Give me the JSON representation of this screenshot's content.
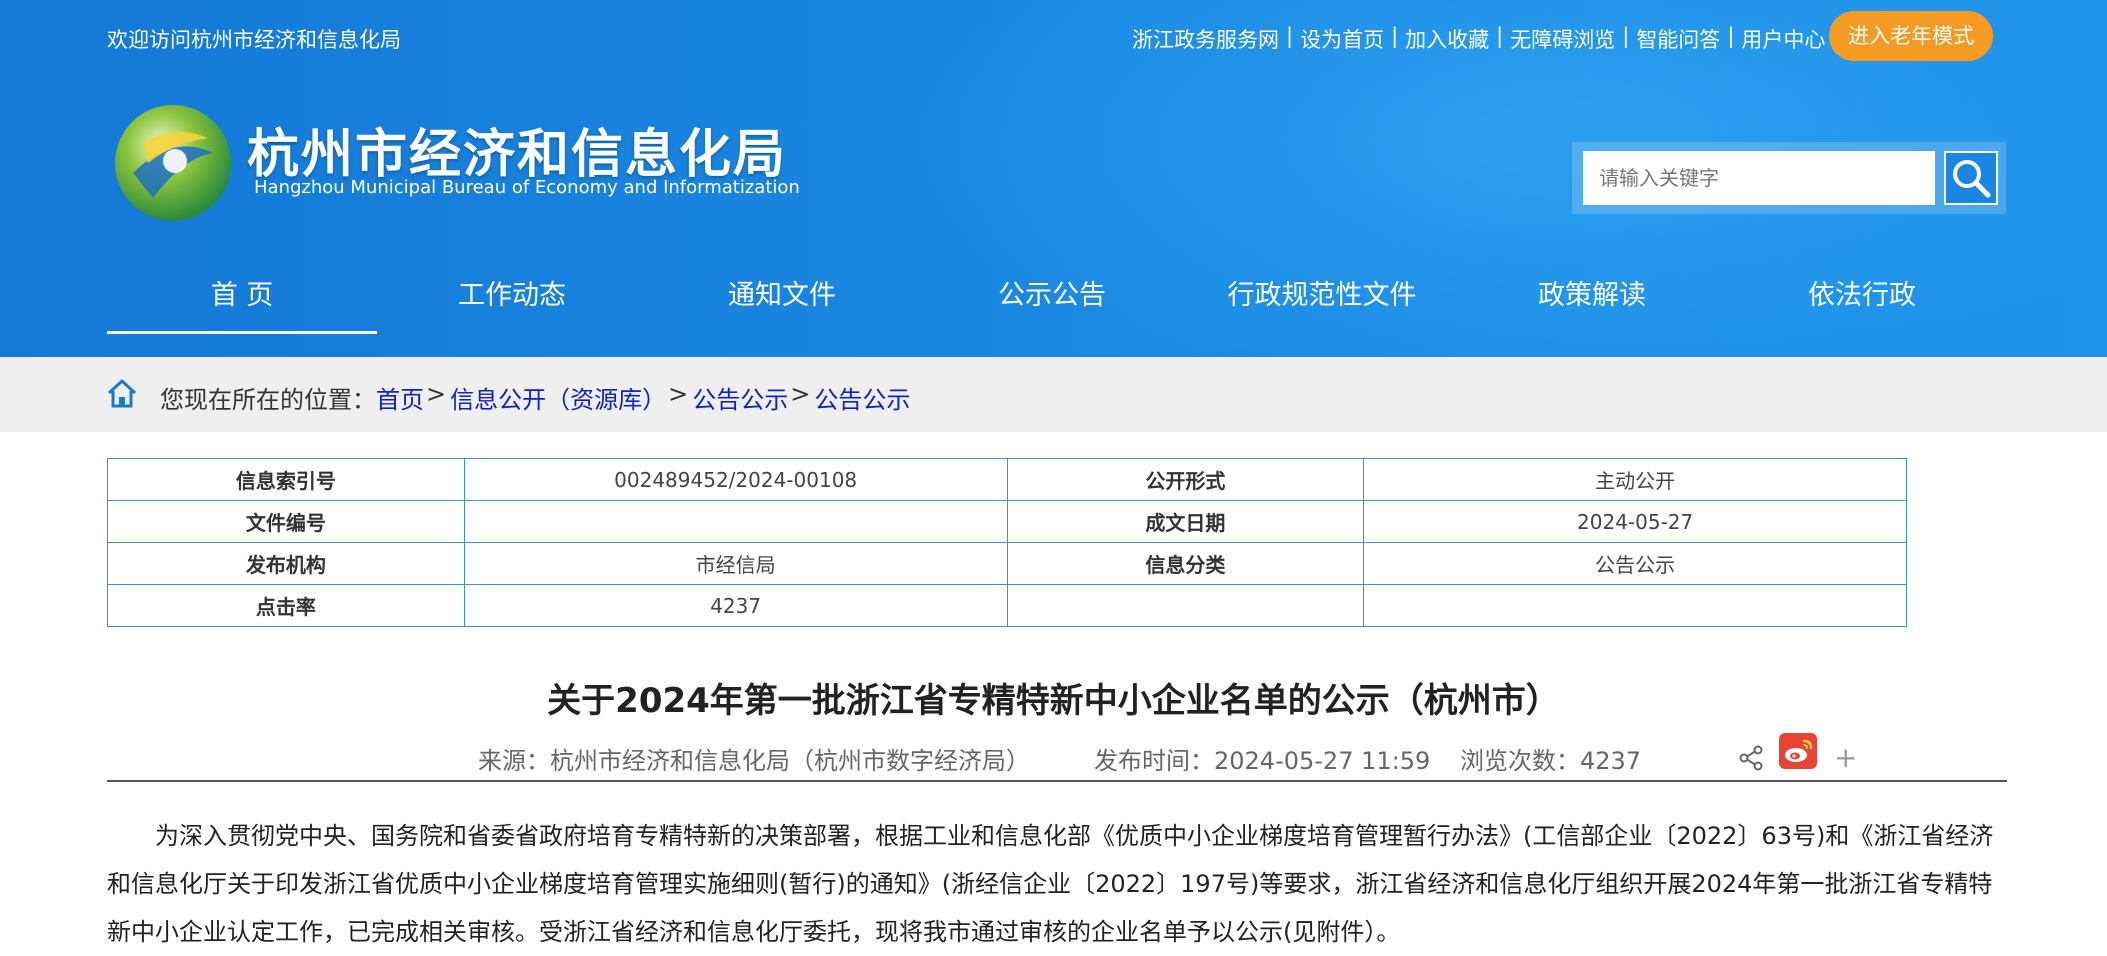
{
  "header": {
    "welcome": "欢迎访问杭州市经济和信息化局",
    "top_links": [
      "浙江政务服务网",
      "设为首页",
      "加入收藏",
      "无障碍浏览",
      "智能问答",
      "用户中心"
    ],
    "separator": "|",
    "elder_mode": "进入老年模式",
    "site_title": "杭州市经济和信息化局",
    "site_subtitle": "Hangzhou Municipal Bureau of Economy and Informatization",
    "search_placeholder": "请输入关键字"
  },
  "nav": {
    "items": [
      "首 页",
      "工作动态",
      "通知文件",
      "公示公告",
      "行政规范性文件",
      "政策解读",
      "依法行政"
    ],
    "active_index": 0
  },
  "breadcrumb": {
    "prefix": "您现在所在的位置：",
    "items": [
      "首页",
      "信息公开（资源库）",
      "公告公示",
      "公告公示"
    ],
    "arrow": ">"
  },
  "info_table": {
    "rows": [
      {
        "label1": "信息索引号",
        "value1": "002489452/2024-00108",
        "label2": "公开形式",
        "value2": "主动公开"
      },
      {
        "label1": "文件编号",
        "value1": "",
        "label2": "成文日期",
        "value2": "2024-05-27"
      },
      {
        "label1": "发布机构",
        "value1": "市经信局",
        "label2": "信息分类",
        "value2": "公告公示"
      },
      {
        "label1": "点击率",
        "value1": "4237",
        "label2": "",
        "value2": ""
      }
    ]
  },
  "article": {
    "title": "关于2024年第一批浙江省专精特新中小企业名单的公示（杭州市）",
    "source": "来源：杭州市经济和信息化局（杭州市数字经济局）",
    "publish_time": "发布时间：2024-05-27 11:59",
    "views": "浏览次数：4237",
    "plus": "+",
    "body": "为深入贯彻党中央、国务院和省委省政府培育专精特新的决策部署，根据工业和信息化部《优质中小企业梯度培育管理暂行办法》(工信部企业〔2022〕63号)和《浙江省经济和信息化厅关于印发浙江省优质中小企业梯度培育管理实施细则(暂行)的通知》(浙经信企业〔2022〕197号)等要求，浙江省经济和信息化厅组织开展2024年第一批浙江省专精特新中小企业认定工作，已完成相关审核。受浙江省经济和信息化厅委托，现将我市通过审核的企业名单予以公示(见附件）。"
  },
  "icons": {
    "home": "home-icon",
    "search": "search-icon",
    "share": "share-icon",
    "weibo": "weibo-icon",
    "plus": "plus-icon",
    "emblem": "site-emblem-icon"
  },
  "colors": {
    "header_blue": "#1a86e2",
    "elder_orange": "#f59a23",
    "link_blue": "#1020c8",
    "table_border": "#3a8fd9",
    "weibo_red": "#e64535"
  }
}
